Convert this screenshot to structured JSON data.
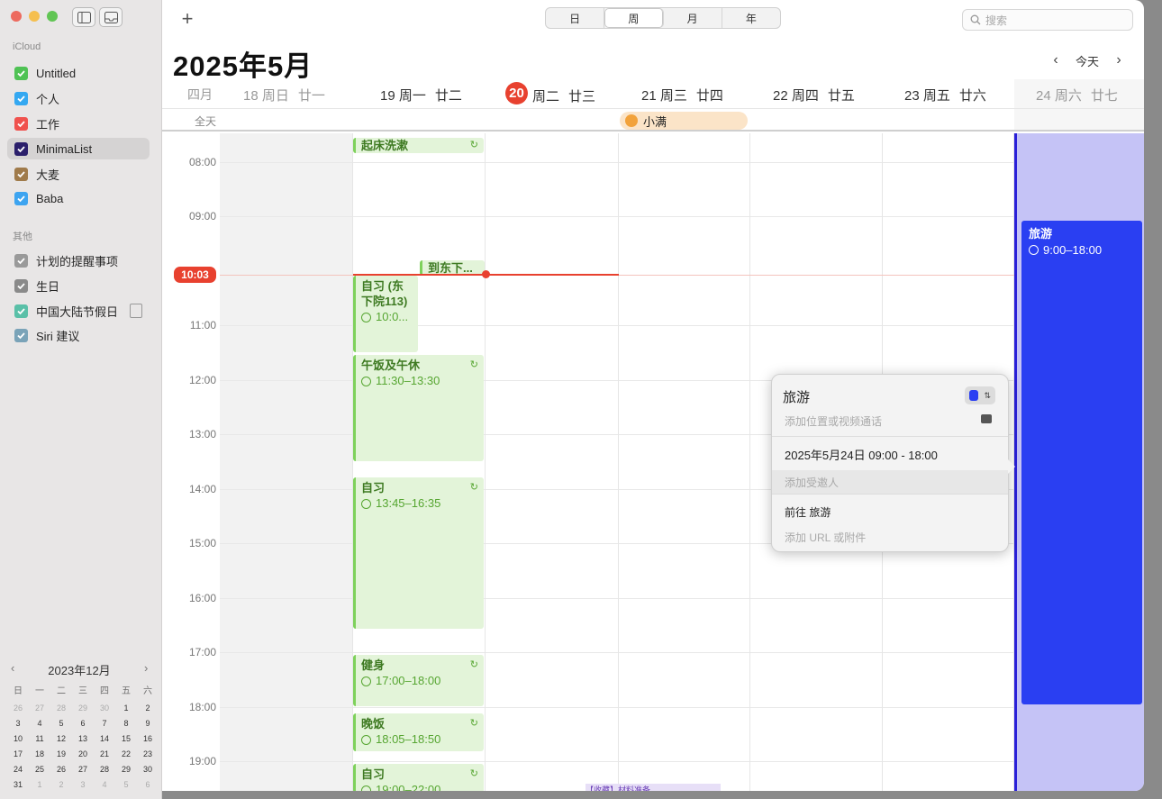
{
  "sidebar": {
    "icloud_header": "iCloud",
    "other_header": "其他",
    "calendars": [
      {
        "label": "Untitled",
        "color": "#4fc254",
        "checked": true
      },
      {
        "label": "个人",
        "color": "#34a8f1",
        "checked": true
      },
      {
        "label": "工作",
        "color": "#f0524e",
        "checked": true
      },
      {
        "label": "MinimaList",
        "color": "#2b1f6b",
        "checked": true
      },
      {
        "label": "大麦",
        "color": "#a07b4b",
        "checked": true
      },
      {
        "label": "Baba",
        "color": "#3da4f0",
        "checked": true
      }
    ],
    "others": [
      {
        "label": "计划的提醒事项",
        "color": "#9a9a9a",
        "checked": true
      },
      {
        "label": "生日",
        "color": "#8a8a8a",
        "checked": true
      },
      {
        "label": "中国大陆节假日",
        "color": "#5ac0a8",
        "checked": true
      },
      {
        "label": "Siri 建议",
        "color": "#7aa3b8",
        "checked": true
      }
    ],
    "mini_calendar": {
      "title": "2023年12月",
      "dow": [
        "日",
        "一",
        "二",
        "三",
        "四",
        "五",
        "六"
      ],
      "days": [
        "26",
        "27",
        "28",
        "29",
        "30",
        "1",
        "2",
        "3",
        "4",
        "5",
        "6",
        "7",
        "8",
        "9",
        "10",
        "11",
        "12",
        "13",
        "14",
        "15",
        "16",
        "17",
        "18",
        "19",
        "20",
        "21",
        "22",
        "23",
        "24",
        "25",
        "26",
        "27",
        "28",
        "29",
        "30",
        "31",
        "1",
        "2",
        "3",
        "4",
        "5",
        "6"
      ]
    }
  },
  "toolbar": {
    "add_label": "+",
    "views": [
      "日",
      "周",
      "月",
      "年"
    ],
    "active_view": "周",
    "search_placeholder": "搜索",
    "today_label": "今天"
  },
  "header": {
    "title": "2025年5月",
    "month_label": "四月",
    "days": [
      {
        "date": "18 周日",
        "lunar": "廿一"
      },
      {
        "date": "19 周一",
        "lunar": "廿二"
      },
      {
        "date": "20",
        "weekday": "周二",
        "lunar": "廿三"
      },
      {
        "date": "21 周三",
        "lunar": "廿四"
      },
      {
        "date": "22 周四",
        "lunar": "廿五"
      },
      {
        "date": "23 周五",
        "lunar": "廿六"
      },
      {
        "date": "24 周六",
        "lunar": "廿七"
      }
    ],
    "allday_label": "全天",
    "allday_event": "小满"
  },
  "timeline": {
    "hours": [
      "08:00",
      "09:00",
      "10:03",
      "11:00",
      "12:00",
      "13:00",
      "14:00",
      "15:00",
      "16:00",
      "17:00",
      "18:00",
      "19:00"
    ],
    "now": "10:03"
  },
  "events": {
    "wake": {
      "title": "起床洗漱"
    },
    "dongxia": {
      "title": "到东下..."
    },
    "study1": {
      "title": "自习 (东下院113)",
      "time": "10:0..."
    },
    "lunch": {
      "title": "午饭及午休",
      "time": "11:30–13:30"
    },
    "study2": {
      "title": "自习",
      "time": "13:45–16:35"
    },
    "gym": {
      "title": "健身",
      "time": "17:00–18:00"
    },
    "dinner": {
      "title": "晚饭",
      "time": "18:05–18:50"
    },
    "study3": {
      "title": "自习",
      "time": "19:00–22:00"
    },
    "trip": {
      "title": "旅游",
      "time": "9:00–18:00"
    }
  },
  "popover": {
    "title": "旅游",
    "location_placeholder": "添加位置或视频通话",
    "datetime": "2025年5月24日  09:00 - 18:00",
    "invitees_placeholder": "添加受邀人",
    "alert": "前往 旅游",
    "url_placeholder": "添加 URL 或附件"
  },
  "bottom_strip": "【收藏】材料准备 ..."
}
